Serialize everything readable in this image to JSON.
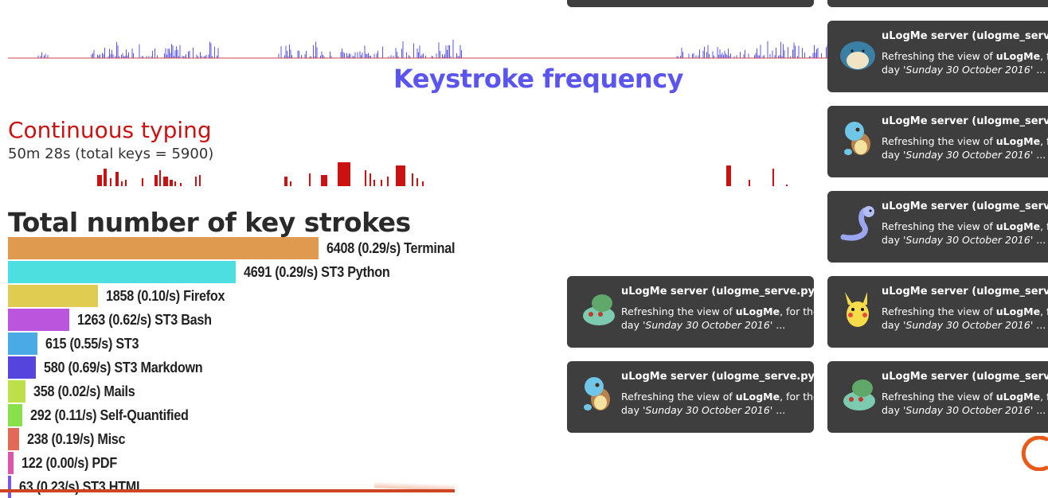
{
  "keystroke_frequency": {
    "title": "Keystroke frequency",
    "color": "#5a55ee"
  },
  "continuous_typing": {
    "title": "Continuous typing",
    "subtitle": "50m 28s (total keys = 5900)",
    "color": "#cc1111"
  },
  "key_strokes": {
    "title": "Total number of key strokes",
    "items": [
      {
        "label": "6408 (0.29/s) Terminal",
        "value": 6408,
        "color": "#e09a4f"
      },
      {
        "label": "4691 (0.29/s) ST3 Python",
        "value": 4691,
        "color": "#4ddfdf"
      },
      {
        "label": "1858 (0.10/s) Firefox",
        "value": 1858,
        "color": "#e0cc50"
      },
      {
        "label": "1263 (0.62/s) ST3 Bash",
        "value": 1263,
        "color": "#bb55dd"
      },
      {
        "label": "615 (0.55/s) ST3",
        "value": 615,
        "color": "#4aaae6"
      },
      {
        "label": "580 (0.69/s) ST3 Markdown",
        "value": 580,
        "color": "#5544dd"
      },
      {
        "label": "358 (0.02/s) Mails",
        "value": 358,
        "color": "#bde04a"
      },
      {
        "label": "292 (0.11/s) Self-Quantified",
        "value": 292,
        "color": "#88e04a"
      },
      {
        "label": "238 (0.19/s) Misc",
        "value": 238,
        "color": "#e06a55"
      },
      {
        "label": "122 (0.00/s) PDF",
        "value": 122,
        "color": "#dd55aa"
      },
      {
        "label": "63 (0.23/s) ST3 HTML",
        "value": 63,
        "color": "#7755ee"
      }
    ]
  },
  "notifications": {
    "title": "uLogMe server (ulogme_serve.py)",
    "body_prefix": "Refreshing the view of ",
    "body_app": "uLogMe",
    "body_mid": ", for the",
    "body_day_prefix": "day '",
    "body_day": "Sunday 30 October 2016",
    "body_suffix": "' ...",
    "items": [
      {
        "pokemon": "snorlax-icon",
        "column": "right"
      },
      {
        "pokemon": "squirtle-icon",
        "column": "right"
      },
      {
        "pokemon": "dratini-icon",
        "column": "right"
      },
      {
        "pokemon": "bulbasaur-icon",
        "column": "left"
      },
      {
        "pokemon": "pikachu-icon",
        "column": "right"
      },
      {
        "pokemon": "squirtle-icon",
        "column": "left"
      },
      {
        "pokemon": "bulbasaur-icon",
        "column": "right"
      }
    ]
  }
}
